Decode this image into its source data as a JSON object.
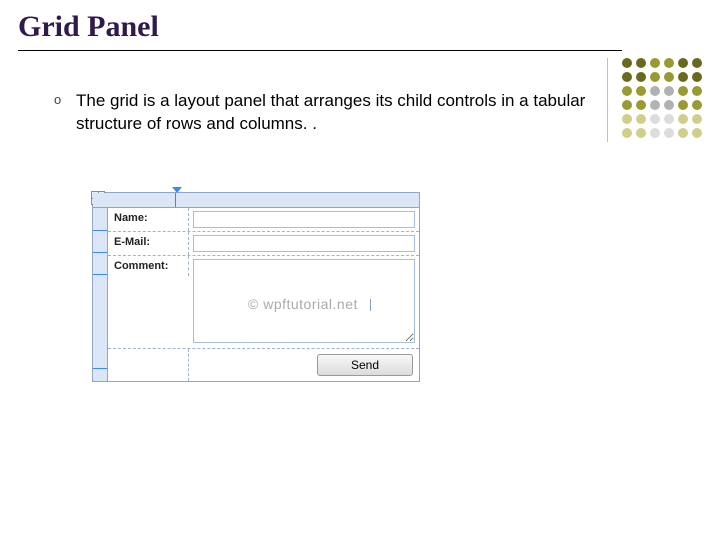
{
  "title": "Grid Panel",
  "bullet": {
    "marker": "o",
    "text": "The grid is a layout panel that arranges its child controls in a tabular structure of rows and columns. ."
  },
  "form": {
    "labels": {
      "name": "Name:",
      "email": "E-Mail:",
      "comment": "Comment:"
    },
    "button": "Send"
  },
  "watermark": "© wpftutorial.net"
}
